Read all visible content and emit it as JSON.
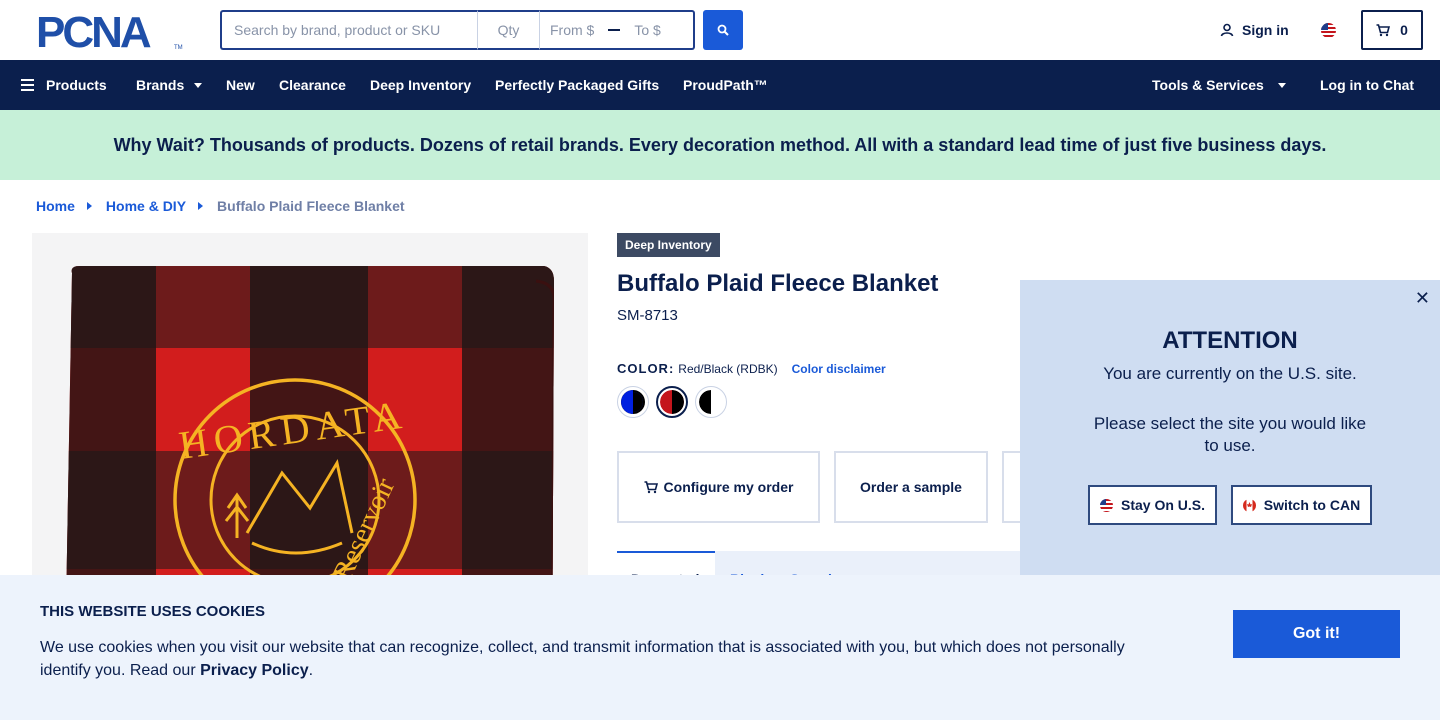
{
  "header": {
    "logo_text": "PCNA",
    "search_placeholder": "Search by brand, product or SKU",
    "qty_placeholder": "Qty",
    "price_from_placeholder": "From $",
    "price_to_placeholder": "To $",
    "signin_label": "Sign in",
    "cart_count": "0"
  },
  "nav": {
    "products": "Products",
    "brands": "Brands",
    "new": "New",
    "clearance": "Clearance",
    "deep_inventory": "Deep Inventory",
    "gifts": "Perfectly Packaged Gifts",
    "proudpath": "ProudPath™",
    "tools": "Tools & Services",
    "chat": "Log in to Chat"
  },
  "promo": {
    "text": "Why Wait? Thousands of products. Dozens of retail brands. Every decoration method. All with a standard lead time of just five business days."
  },
  "breadcrumb": {
    "home": "Home",
    "category": "Home & DIY",
    "current": "Buffalo Plaid Fleece Blanket"
  },
  "product": {
    "badge": "Deep Inventory",
    "title": "Buffalo Plaid Fleece Blanket",
    "sku": "SM-8713",
    "color_label": "COLOR:",
    "color_value": "Red/Black (RDBK)",
    "color_disclaimer": "Color disclaimer",
    "swatches": [
      {
        "name": "Blue/Black",
        "colors": [
          "#0020e0",
          "#000000"
        ]
      },
      {
        "name": "Red/Black",
        "colors": [
          "#c4151c",
          "#000000"
        ]
      },
      {
        "name": "White/Black",
        "colors": [
          "#ffffff",
          "#000000"
        ]
      }
    ],
    "configure_label": "Configure my order",
    "sample_label": "Order a sample",
    "tab_active": "Decorated",
    "tab_other": "Blank or Sample",
    "imprint_text": "HORDATA",
    "imprint_sub": "Reservoir"
  },
  "attention": {
    "heading": "ATTENTION",
    "message": "You are currently on the U.S. site.",
    "message2": "Please select the site you would like to use.",
    "stay_label": "Stay On U.S.",
    "switch_label": "Switch to CAN"
  },
  "cookie": {
    "title": "THIS WEBSITE USES COOKIES",
    "text": "We use cookies when you visit our website that can recognize, collect, and transmit information that is associated with you, but which does not personally identify you. Read our ",
    "policy_link": "Privacy Policy",
    "text_end": ".",
    "button": "Got it!"
  },
  "colors": {
    "navy": "#0b1f4d",
    "accent_blue": "#1a5ad8",
    "promo_green": "#c6f0d8",
    "popup_bg": "#cfddf2",
    "cookie_bg": "#edf3fc"
  }
}
